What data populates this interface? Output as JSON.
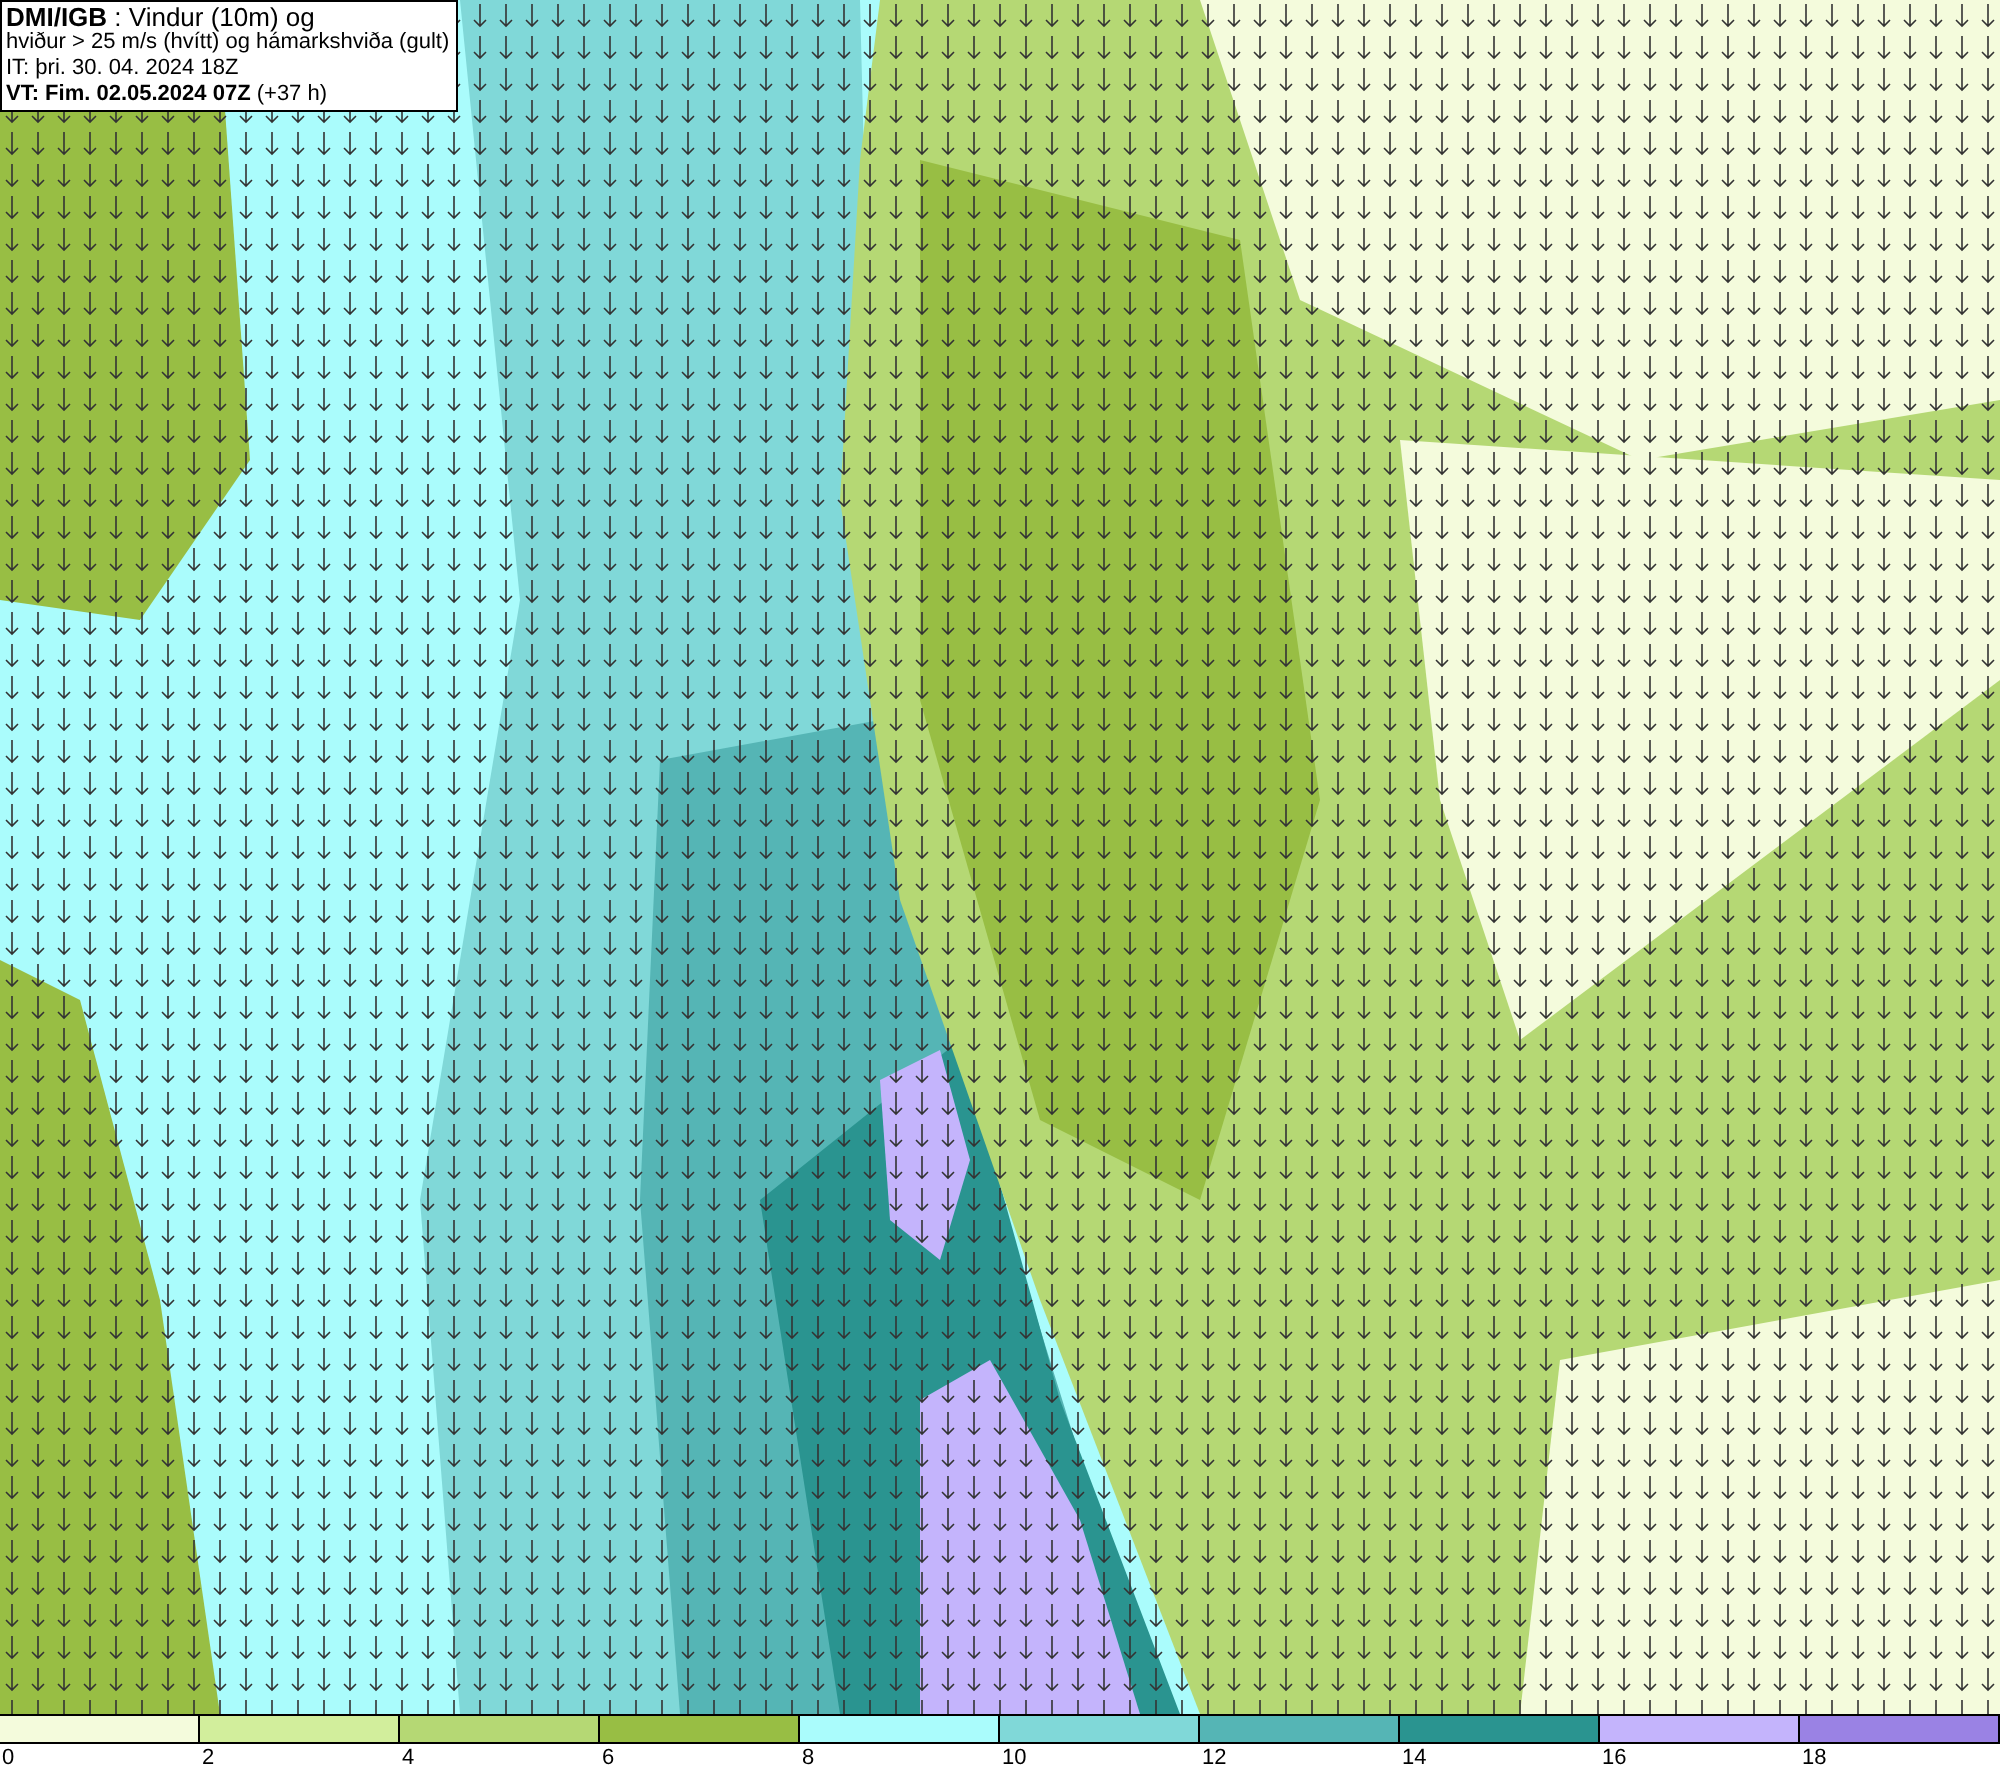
{
  "title_box": {
    "lines": [
      "**DMI/IGB** : Vindur (10m) og",
      "hviður > 25 m/s (hvítt) og hámarkshviða (gult)",
      "IT: þri. 30. 04. 2024 18Z",
      "**VT: Fim. 02.05.2024 07Z** (+37 h)"
    ]
  },
  "legend": [
    {
      "label": "0",
      "color": "#f4fbdc"
    },
    {
      "label": "2",
      "color": "#d2ee9c"
    },
    {
      "label": "4",
      "color": "#b5d874"
    },
    {
      "label": "6",
      "color": "#98be44"
    },
    {
      "label": "8",
      "color": "#aafcfc"
    },
    {
      "label": "10",
      "color": "#80d8d8"
    },
    {
      "label": "12",
      "color": "#55b5b5"
    },
    {
      "label": "14",
      "color": "#2a9490"
    },
    {
      "label": "16",
      "color": "#c4b4fc"
    },
    {
      "label": "18",
      "color": "#9a82e4"
    }
  ]
}
